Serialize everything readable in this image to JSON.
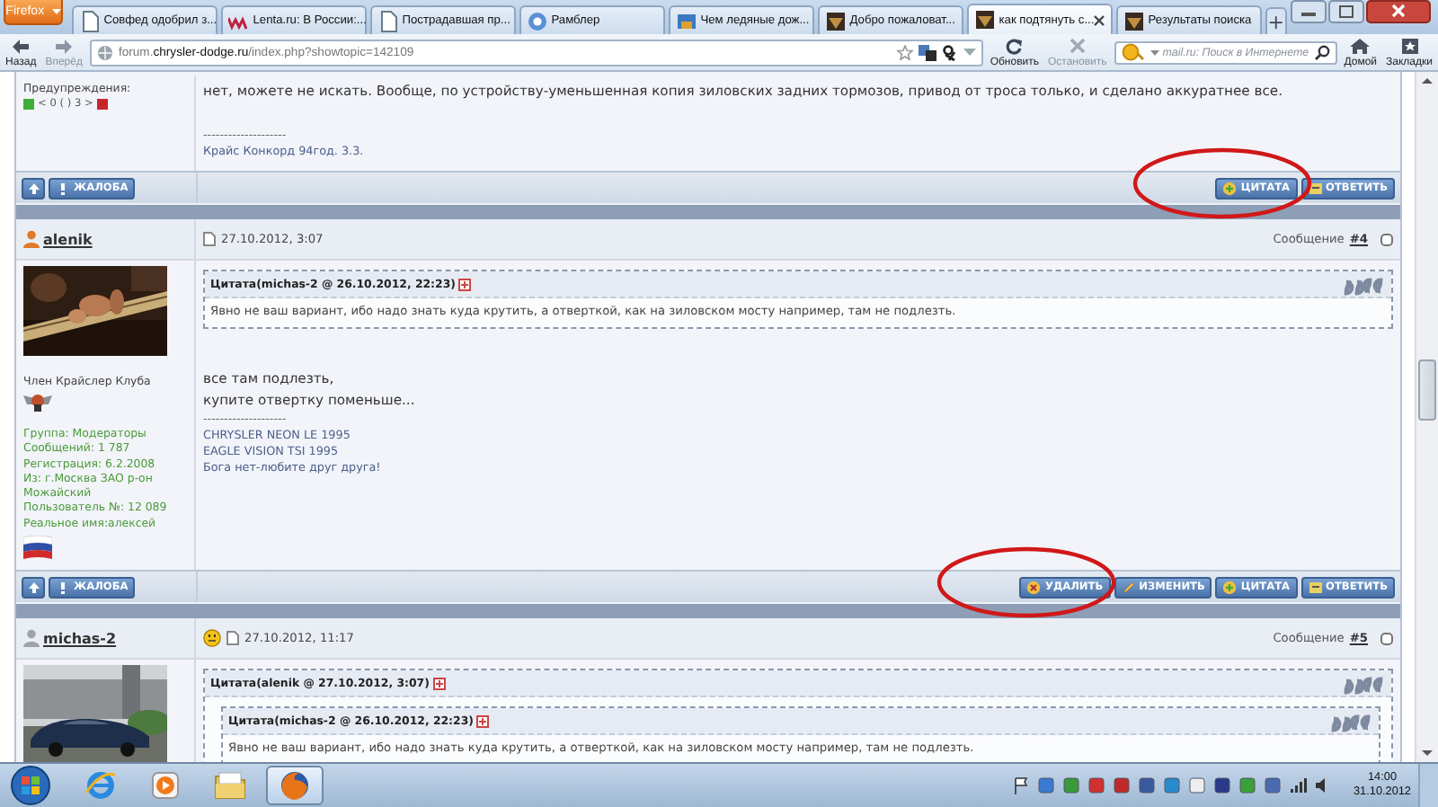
{
  "browser": {
    "menu_button": "Firefox",
    "tabs": [
      {
        "label": "Совфед одобрил з...",
        "kind": "page",
        "selected": false
      },
      {
        "label": "Lenta.ru: В России:...",
        "kind": "lenta",
        "selected": false
      },
      {
        "label": "Пострадавшая пр...",
        "kind": "page",
        "selected": false
      },
      {
        "label": "Рамблер",
        "kind": "rambler",
        "selected": false
      },
      {
        "label": "Чем ледяные дож...",
        "kind": "globe",
        "selected": false
      },
      {
        "label": "Добро пожаловат...",
        "kind": "forum",
        "selected": false
      },
      {
        "label": "как подтянуть с...",
        "kind": "forum",
        "selected": true
      },
      {
        "label": "Результаты поиска",
        "kind": "forum",
        "selected": false
      }
    ],
    "new_tab": "+",
    "history": [
      {
        "kind": "back",
        "label": "Назад",
        "disabled": false
      },
      {
        "kind": "forward",
        "label": "Вперёд",
        "disabled": true
      }
    ],
    "url": "forum.**chrysler-dodge.ru**/index.php?showtopic=142109",
    "actions": [
      {
        "kind": "reload",
        "label": "Обновить",
        "disabled": false
      },
      {
        "kind": "stop",
        "label": "Остановить",
        "disabled": true
      }
    ],
    "search": {
      "placeholder": "mail.ru: Поиск в Интернете"
    },
    "end_buttons": [
      {
        "kind": "home",
        "label": "Домой"
      },
      {
        "kind": "bookmarks",
        "label": "Закладки"
      }
    ]
  },
  "posts": [
    {
      "sidebar": [
        {
          "kind": "warnings",
          "label": "Предупреждения:",
          "value": "< 0 ( ) 3 >"
        }
      ],
      "content": [
        {
          "kind": "text",
          "lines": [
            "нет, можете не искать. Вообще, по устройству-уменьшенная копия зиловских задних тормозов, привод от троса только, и сделано аккуратнее все."
          ]
        },
        {
          "kind": "signature",
          "divider": "--------------------",
          "lines": [
            "Крайс Конкорд 94год. 3.3."
          ]
        }
      ],
      "footer": {
        "left": [
          {
            "kind": "top"
          },
          {
            "kind": "report",
            "label": "ЖАЛОБА"
          }
        ],
        "right": [
          {
            "kind": "quote",
            "label": "ЦИТАТА"
          },
          {
            "kind": "reply",
            "label": "ОТВЕТИТЬ"
          }
        ],
        "circled": true
      }
    },
    {
      "header": {
        "author": "alenik",
        "online": true,
        "mood": false,
        "date": "27.10.2012, 3:07",
        "post_label": "Сообщение",
        "post_number": "#4",
        "checked": false
      },
      "sidebar": [
        {
          "kind": "picture"
        },
        {
          "kind": "title",
          "text": "Член Крайслер Клуба"
        },
        {
          "kind": "badge"
        },
        {
          "kind": "info",
          "lines": [
            "Группа: Модераторы",
            "Сообщений: 1 787",
            "Регистрация: 6.2.2008",
            "Из: г.Москва ЗАО р-он Можайский",
            "Пользователь №: 12 089",
            "Реальное имя:алексей"
          ]
        },
        {
          "kind": "flag"
        }
      ],
      "content": [
        {
          "kind": "quote",
          "title": "Цитата(michas-2 @ 26.10.2012, 22:23)",
          "children": [
            {
              "kind": "text",
              "lines": [
                "Явно не ваш вариант, ибо надо знать куда крутить, а отверткой, как на зиловском мосту например, там не подлезть."
              ]
            }
          ]
        },
        {
          "kind": "text",
          "lines": [
            "все там подлезть,",
            "купите отвертку поменьше..."
          ]
        },
        {
          "kind": "signature",
          "divider": "--------------------",
          "lines": [
            "CHRYSLER NEON LE 1995",
            "EAGLE VISION TSI 1995",
            "Бога нет-любите друг друга!"
          ]
        }
      ],
      "footer": {
        "left": [
          {
            "kind": "top"
          },
          {
            "kind": "report",
            "label": "ЖАЛОБА"
          }
        ],
        "right": [
          {
            "kind": "delete",
            "label": "УДАЛИТЬ"
          },
          {
            "kind": "edit",
            "label": "ИЗМЕНИТЬ"
          },
          {
            "kind": "quote",
            "label": "ЦИТАТА"
          },
          {
            "kind": "reply",
            "label": "ОТВЕТИТЬ"
          }
        ],
        "circled": true
      }
    },
    {
      "header": {
        "author": "michas-2",
        "online": false,
        "mood": true,
        "date": "27.10.2012, 11:17",
        "post_label": "Сообщение",
        "post_number": "#5",
        "checked": false
      },
      "sidebar": [
        {
          "kind": "picture"
        }
      ],
      "content": [
        {
          "kind": "quote",
          "title": "Цитата(alenik @ 27.10.2012, 3:07)",
          "children": [
            {
              "kind": "quote",
              "title": "Цитата(michas-2 @ 26.10.2012, 22:23)",
              "children": [
                {
                  "kind": "text",
                  "lines": [
                    "Явно не ваш вариант, ибо надо знать куда крутить, а отверткой, как на зиловском мосту например, там не подлезть."
                  ]
                }
              ]
            }
          ]
        }
      ]
    }
  ],
  "taskbar": {
    "apps": [
      {
        "kind": "ie",
        "selected": false
      },
      {
        "kind": "media",
        "selected": false
      },
      {
        "kind": "explorer",
        "selected": false
      },
      {
        "kind": "firefox",
        "selected": true
      }
    ],
    "clock": {
      "time": "14:00",
      "date": "31.10.2012"
    }
  }
}
